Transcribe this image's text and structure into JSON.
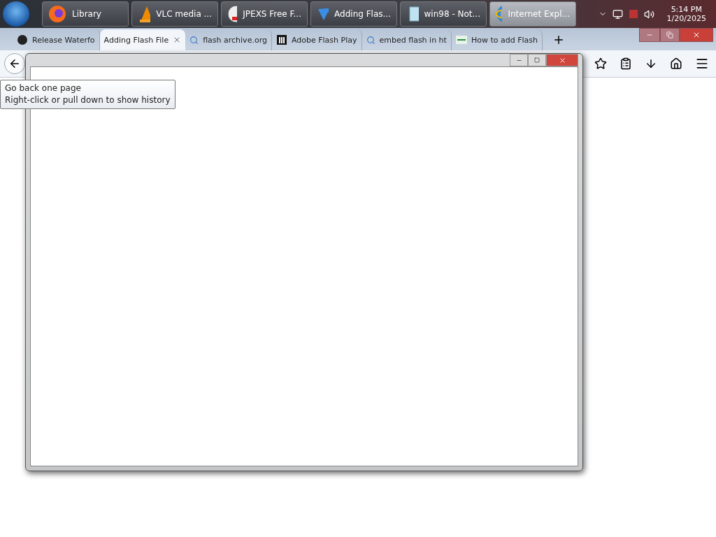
{
  "taskbar": {
    "items": [
      {
        "label": "Library",
        "selected": false
      },
      {
        "label": "VLC media ...",
        "selected": false
      },
      {
        "label": "JPEXS Free F...",
        "selected": false
      },
      {
        "label": "Adding Flas...",
        "selected": false
      },
      {
        "label": "win98 - Not...",
        "selected": false
      },
      {
        "label": "Internet Expl...",
        "selected": true
      }
    ],
    "clock": {
      "time": "5:14 PM",
      "date": "1/20/2025"
    }
  },
  "tabs": [
    {
      "label": "Release Waterfo",
      "selected": false
    },
    {
      "label": "Adding Flash File",
      "selected": true
    },
    {
      "label": "flash archive.org",
      "selected": false
    },
    {
      "label": "Adobe Flash Play",
      "selected": false
    },
    {
      "label": "embed flash in ht",
      "selected": false
    },
    {
      "label": "How to add Flash",
      "selected": false
    }
  ],
  "tooltip": {
    "lines": [
      "Go back one page",
      "Right-click or pull down to show history"
    ]
  }
}
